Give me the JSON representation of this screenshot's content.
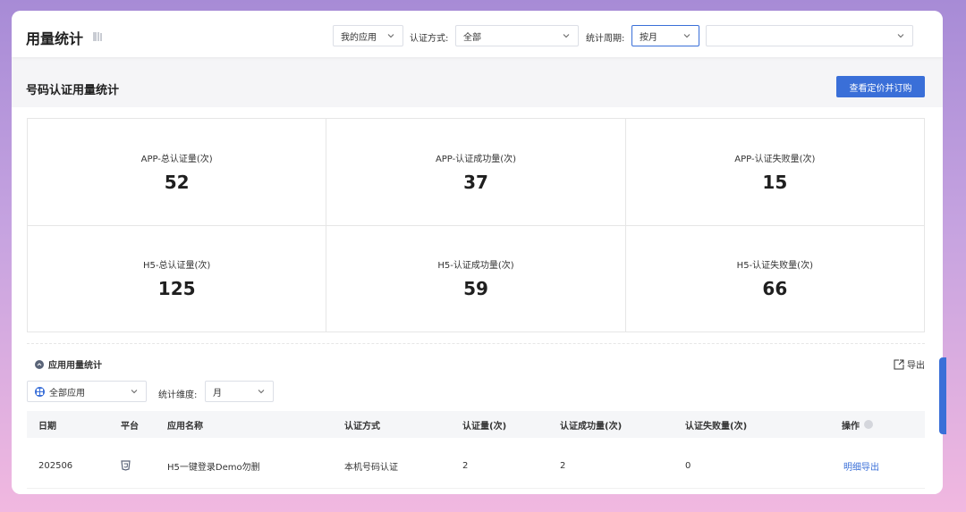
{
  "header": {
    "title": "用量统计",
    "app_select": "我的应用",
    "auth_label": "认证方式:",
    "auth_select": "全部",
    "period_label": "统计周期:",
    "period_select": "按月",
    "date_select": ""
  },
  "section": {
    "title": "号码认证用量统计",
    "buy_button": "查看定价并订购"
  },
  "stats": [
    {
      "label": "APP-总认证量(次)",
      "value": "52"
    },
    {
      "label": "APP-认证成功量(次)",
      "value": "37"
    },
    {
      "label": "APP-认证失败量(次)",
      "value": "15"
    },
    {
      "label": "H5-总认证量(次)",
      "value": "125"
    },
    {
      "label": "H5-认证成功量(次)",
      "value": "59"
    },
    {
      "label": "H5-认证失败量(次)",
      "value": "66"
    }
  ],
  "usage": {
    "title": "应用用量统计",
    "export": "导出",
    "app_filter": "全部应用",
    "dimension_label": "统计维度:",
    "dimension_select": "月"
  },
  "table": {
    "columns": [
      "日期",
      "平台",
      "应用名称",
      "认证方式",
      "认证量(次)",
      "认证成功量(次)",
      "认证失败量(次)",
      "操作"
    ],
    "rows": [
      {
        "date": "202506",
        "app_name": "H5一键登录Demo勿删",
        "auth_method": "本机号码认证",
        "total": "2",
        "success": "2",
        "fail": "0",
        "action": "明细导出"
      }
    ]
  },
  "colors": {
    "accent": "#3a6fd8"
  }
}
